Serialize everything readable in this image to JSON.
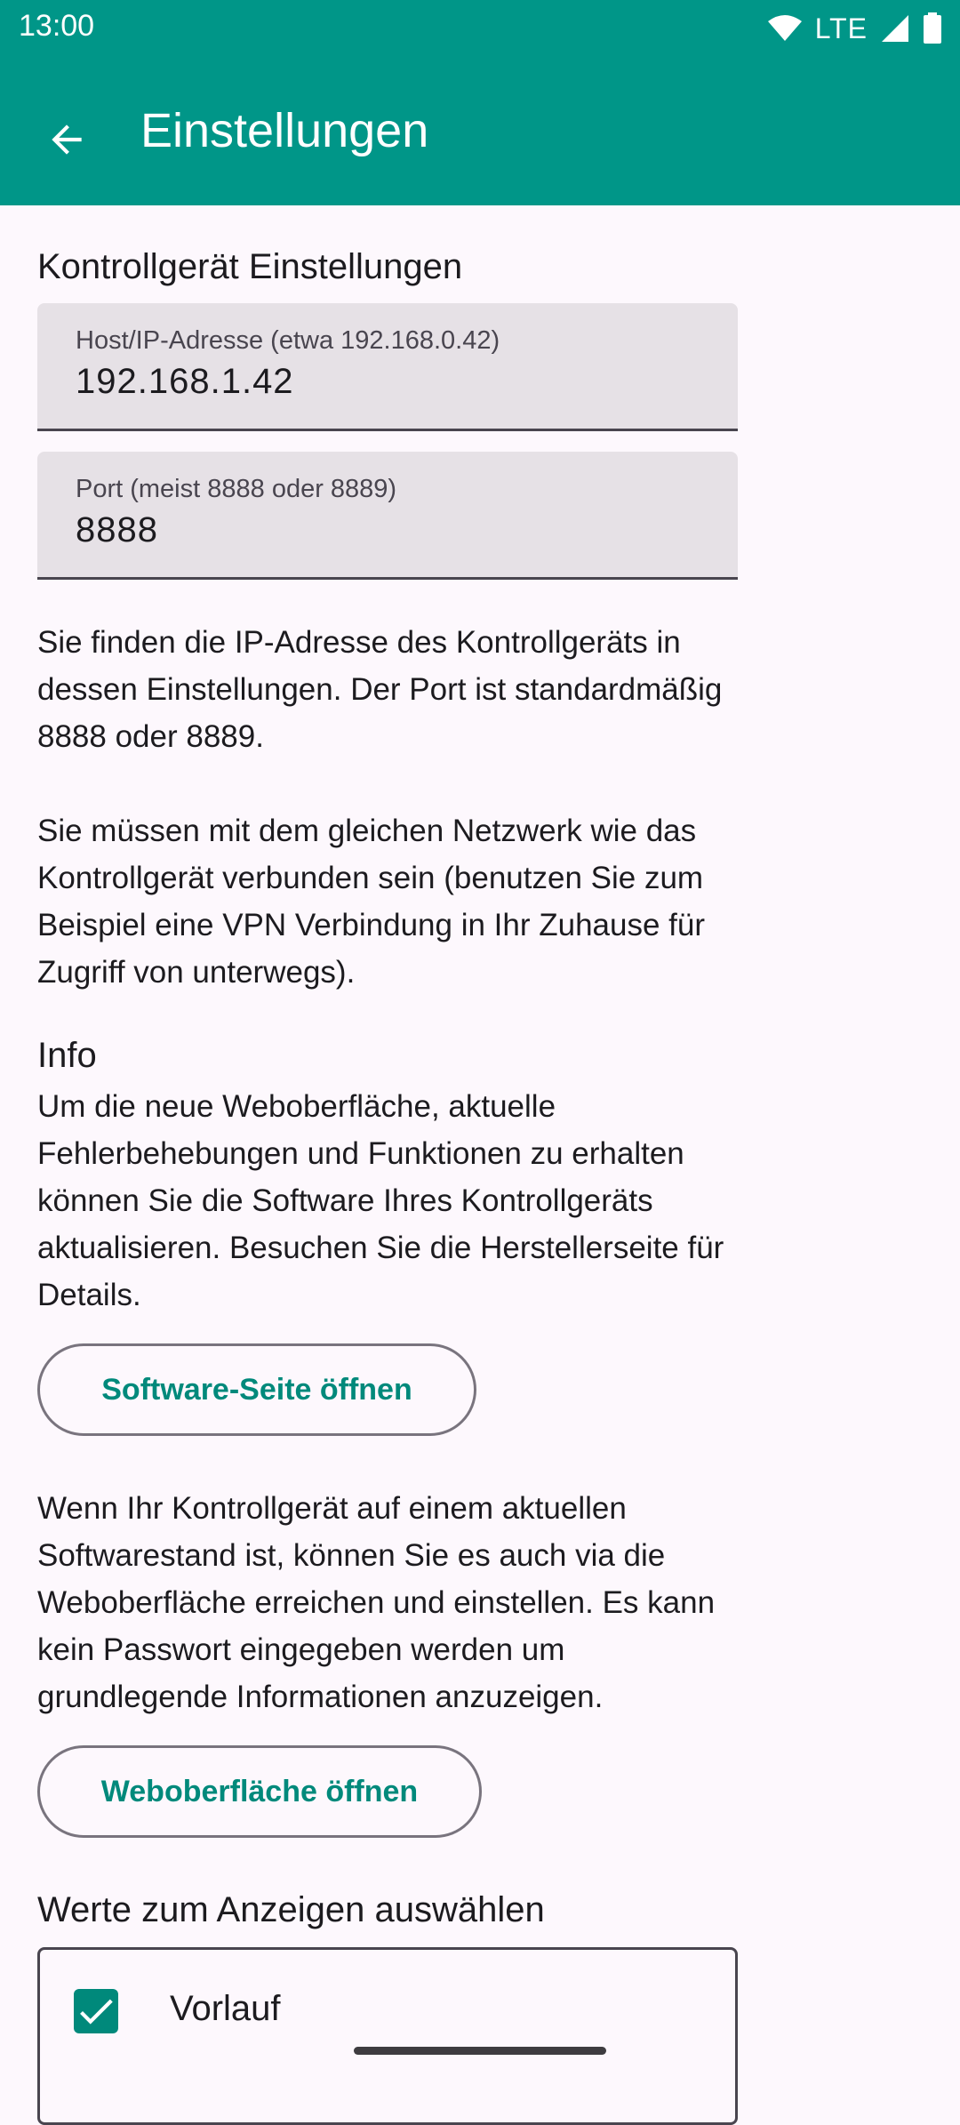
{
  "status_bar": {
    "time": "13:00",
    "network": "LTE",
    "icons": [
      "wifi-icon",
      "signal-icon",
      "battery-icon"
    ]
  },
  "app_bar": {
    "title": "Einstellungen",
    "back_icon": "arrow-back-icon"
  },
  "controller_settings": {
    "heading": "Kontrollgerät Einstellungen",
    "host_field": {
      "label": "Host/IP-Adresse (etwa 192.168.0.42)",
      "value": "192.168.1.42"
    },
    "port_field": {
      "label": "Port (meist 8888 oder 8889)",
      "value": "8888"
    },
    "help_text_1": "Sie finden die IP-Adresse des Kontrollgeräts in dessen Einstellungen. Der Port ist standardmäßig 8888 oder 8889.",
    "help_text_2": "Sie müssen mit dem gleichen Netzwerk wie das Kontrollgerät verbunden sein (benutzen Sie zum Beispiel eine VPN Verbindung in Ihr Zuhause für Zugriff von unterwegs)."
  },
  "info": {
    "heading": "Info",
    "text_1": "Um die neue Weboberfläche, aktuelle Fehlerbehebungen und Funktionen zu erhalten können Sie die Software Ihres Kontrollgeräts aktualisieren. Besuchen Sie die Herstellerseite für Details.",
    "software_button": "Software-Seite öffnen",
    "text_2": "Wenn Ihr Kontrollgerät auf einem aktuellen Softwarestand ist, können Sie es auch via die Weboberfläche erreichen und einstellen. Es kann kein Passwort eingegeben werden um grundlegende Informationen anzuzeigen.",
    "web_button": "Weboberfläche öffnen"
  },
  "values_section": {
    "heading": "Werte zum Anzeigen auswählen",
    "items": [
      {
        "label": "Vorlauf",
        "checked": true
      }
    ]
  },
  "colors": {
    "primary": "#009688",
    "accent": "#00897b",
    "background": "#fdf8fd",
    "field_bg": "#e6e1e6"
  }
}
